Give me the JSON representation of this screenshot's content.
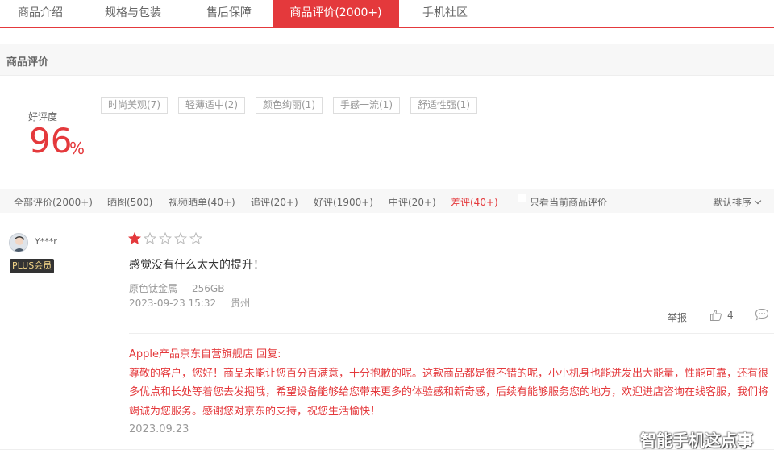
{
  "tabs": [
    {
      "label": "商品介绍",
      "active": false
    },
    {
      "label": "规格与包装",
      "active": false
    },
    {
      "label": "售后保障",
      "active": false
    },
    {
      "label": "商品评价(2000+)",
      "active": true
    },
    {
      "label": "手机社区",
      "active": false
    }
  ],
  "section": {
    "title": "商品评价"
  },
  "rating": {
    "label": "好评度",
    "value": "96",
    "unit": "%"
  },
  "tags": [
    "时尚美观(7)",
    "轻薄适中(2)",
    "颜色绚丽(1)",
    "手感一流(1)",
    "舒适性强(1)"
  ],
  "filters": {
    "all": "全部评价(2000+)",
    "photo": "晒图(500)",
    "video": "视频晒单(40+)",
    "append": "追评(20+)",
    "good": "好评(1900+)",
    "medium": "中评(20+)",
    "bad": "差评(40+)",
    "current_only": "只看当前商品评价",
    "sort": "默认排序"
  },
  "colors": {
    "accent": "#e4393c",
    "plus_gold": "#f6d889"
  },
  "review": {
    "user": "Y***r",
    "badge": "PLUS会员",
    "stars": 1,
    "max_stars": 5,
    "content": "感觉没有什么太大的提升！",
    "color": "原色钛金属",
    "storage": "256GB",
    "datetime": "2023-09-23 15:32",
    "location": "贵州",
    "report": "举报",
    "likes": "4",
    "reply": {
      "author": "Apple产品京东自营旗舰店 回复:",
      "text": "尊敬的客户，您好！商品未能让您百分百满意，十分抱歉的呢。这款商品都是很不错的呢，小小机身也能迸发出大能量，性能可靠，还有很多优点和长处等着您去发掘哦，希望设备能够给您带来更多的体验感和新奇感，后续有能够服务您的地方，欢迎进店咨询在线客服，我们将竭诚为您服务。感谢您对京东的支持，祝您生活愉快！",
      "date": "2023.09.23"
    }
  },
  "watermark": "智能手机这点事"
}
